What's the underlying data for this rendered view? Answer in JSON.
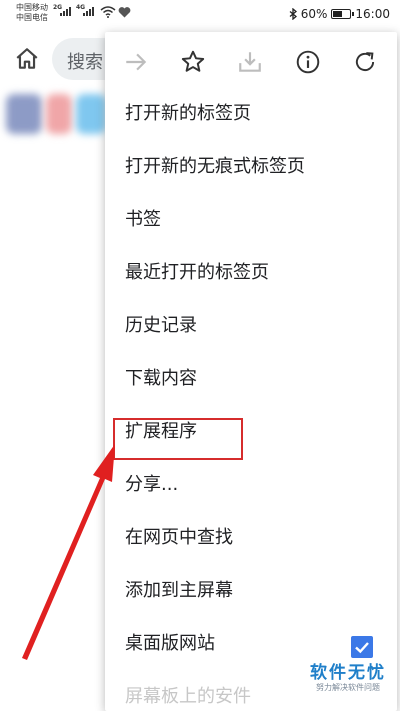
{
  "status_bar": {
    "carrier_1": "中国移动",
    "carrier_2": "中国电信",
    "net_1": "2G",
    "net_2": "4G",
    "battery_text": "60%",
    "battery_level": 0.6,
    "time": "16:00"
  },
  "toolbar": {
    "search_placeholder": "搜索",
    "icons": [
      "home-icon",
      "forward-arrow-icon",
      "star-icon",
      "download-icon",
      "info-icon",
      "refresh-icon"
    ]
  },
  "menu": {
    "items": [
      {
        "label": "打开新的标签页"
      },
      {
        "label": "打开新的无痕式标签页"
      },
      {
        "label": "书签"
      },
      {
        "label": "最近打开的标签页"
      },
      {
        "label": "历史记录"
      },
      {
        "label": "下载内容"
      },
      {
        "label": "扩展程序"
      },
      {
        "label": "分享..."
      },
      {
        "label": "在网页中查找"
      },
      {
        "label": "添加到主屏幕"
      },
      {
        "label": "桌面版网站"
      }
    ],
    "desktop_site_checked": true,
    "cut_off_item": "屏幕板上的安件"
  },
  "annotation": {
    "highlight_color": "#d62c2c",
    "arrow_color": "#e02020"
  },
  "watermark": {
    "title": "软件无忧",
    "subtitle": "努力解决软件问题"
  },
  "colors": {
    "checkbox": "#3b78e7",
    "omnibox_bg": "#eceff1"
  }
}
